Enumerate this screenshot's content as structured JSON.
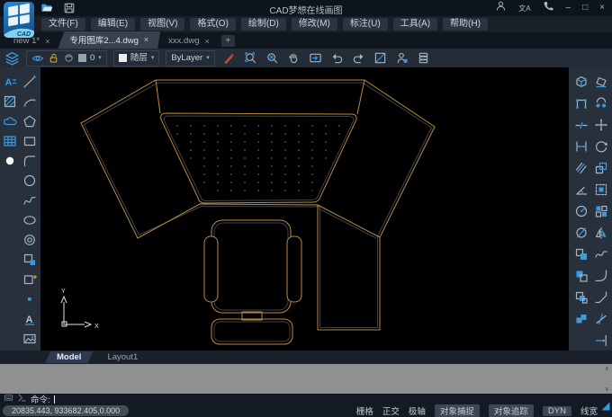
{
  "window": {
    "title": "CAD梦想在线画图",
    "logo_text": "CAD"
  },
  "icons": {
    "window_min": "–",
    "window_max": "□",
    "window_close": "×",
    "translate": "文A",
    "tab_close": "×",
    "tab_add": "+",
    "dropdown": "▾",
    "scroll_up": "∧",
    "scroll_down": "∨"
  },
  "menubar": {
    "items": [
      "文件(F)",
      "编辑(E)",
      "视图(V)",
      "格式(O)",
      "绘制(D)",
      "修改(M)",
      "标注(U)",
      "工具(A)",
      "帮助(H)"
    ]
  },
  "doc_tabs": {
    "tabs": [
      {
        "label": "new 1*",
        "active": false
      },
      {
        "label": "专用图库2...4.dwg",
        "active": true
      },
      {
        "label": "xxx.dwg",
        "active": false
      }
    ]
  },
  "toolbar": {
    "layer": "0",
    "color_mode": "随层",
    "linetype": "ByLayer",
    "button_icons": [
      "layer-panel",
      "layer-visibility",
      "layer-unlock",
      "layer-freeze",
      "layer-color-swatch",
      "color-swatch",
      "match-properties",
      "zoom-window",
      "zoom-extents",
      "pan",
      "zoom-previous",
      "undo",
      "redo",
      "measure",
      "user-profile",
      "layer-manager"
    ]
  },
  "left_sidebar": {
    "col1_icons": [
      "text-style",
      "hatch",
      "revision-cloud",
      "table",
      "point-style-active"
    ],
    "col2_icons": [
      "line",
      "arc",
      "polygon",
      "rectangle",
      "fillet-corner",
      "circle",
      "spline",
      "ellipse",
      "donut",
      "block",
      "insert-block",
      "point",
      "text",
      "image"
    ]
  },
  "right_sidebar": {
    "col1_icons": [
      "box-3d",
      "polyline-edit",
      "break",
      "dim-linear",
      "dim-aligned",
      "dim-angular",
      "dim-radius",
      "dim-diameter",
      "copy-base",
      "paste-block",
      "paste-coords",
      "group"
    ],
    "col2_icons": [
      "erase",
      "copy",
      "move",
      "rotate",
      "offset",
      "scale",
      "array",
      "mirror",
      "spline-fit",
      "fillet",
      "chamfer",
      "trim",
      "extend"
    ]
  },
  "canvas": {
    "background": "#000000",
    "line_color": "#bd8a3e",
    "inner_edge_color": "#3c4350",
    "objects": [
      "desk-workstation",
      "keyboard-panel-dotted",
      "return-desk",
      "office-chair",
      "ucs-icon"
    ],
    "ucs_x": "X",
    "ucs_y": "Y"
  },
  "layout_tabs": {
    "model": "Model",
    "layout1": "Layout1"
  },
  "command": {
    "prompt": "命令:"
  },
  "statusbar": {
    "coords": "20835.443, 933682.405,0.000",
    "toggles": [
      {
        "label": "栅格",
        "active": false
      },
      {
        "label": "正交",
        "active": false
      },
      {
        "label": "极轴",
        "active": false
      },
      {
        "label": "对象捕捉",
        "active": true
      },
      {
        "label": "对象追踪",
        "active": true
      },
      {
        "label": "DYN",
        "active": true
      },
      {
        "label": "线宽",
        "active": false
      }
    ]
  }
}
